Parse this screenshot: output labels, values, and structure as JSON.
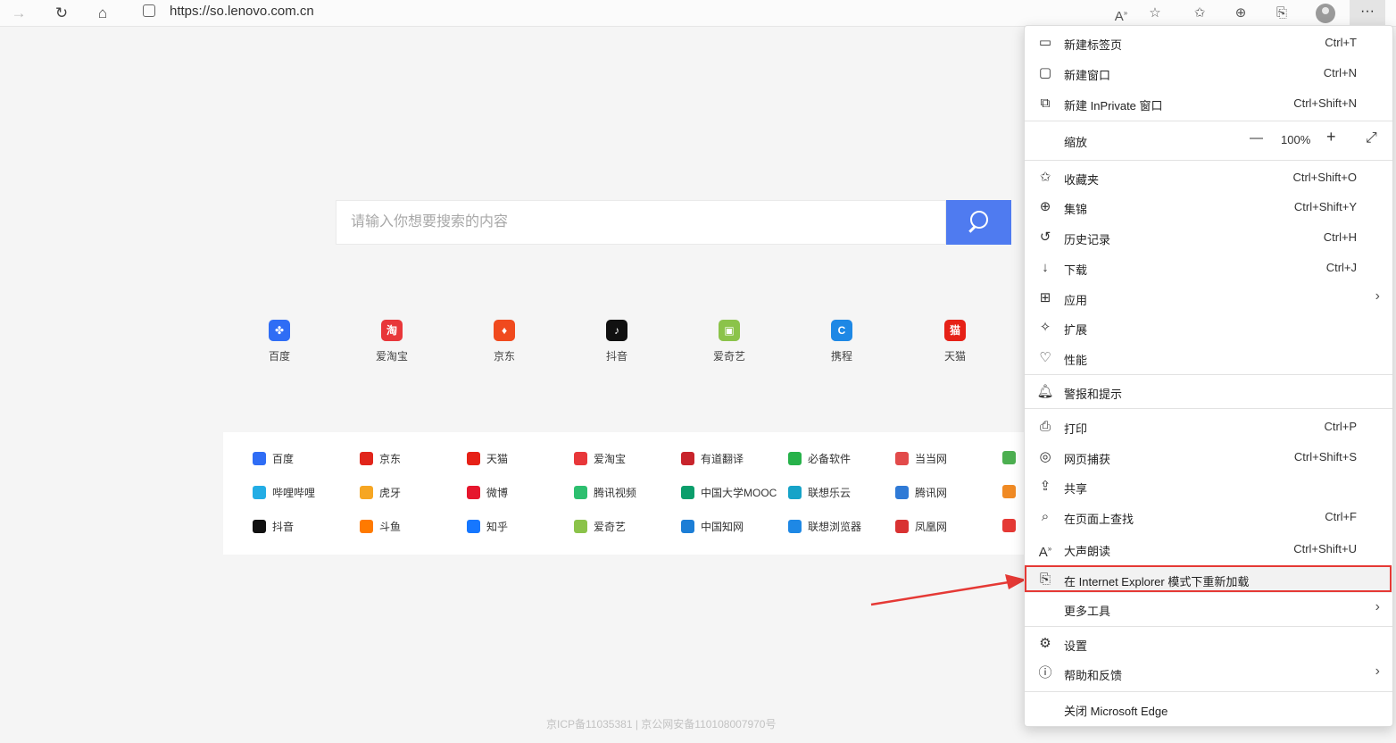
{
  "browser": {
    "url": "https://so.lenovo.com.cn",
    "more_label": "···"
  },
  "search": {
    "placeholder": "请输入你想要搜索的内容"
  },
  "quick_links": [
    {
      "label": "百度",
      "icon": "baidu-icon",
      "color": "#2f6df5",
      "glyph": "✤"
    },
    {
      "label": "爱淘宝",
      "icon": "taobao-icon",
      "color": "#e8373a",
      "glyph": "淘"
    },
    {
      "label": "京东",
      "icon": "jd-icon",
      "color": "#f04a1e",
      "glyph": "♦"
    },
    {
      "label": "抖音",
      "icon": "douyin-icon",
      "color": "#111111",
      "glyph": "♪"
    },
    {
      "label": "爱奇艺",
      "icon": "iqiyi-icon",
      "color": "#8bc34a",
      "glyph": "▣"
    },
    {
      "label": "携程",
      "icon": "ctrip-icon",
      "color": "#1e88e5",
      "glyph": "C"
    },
    {
      "label": "天猫",
      "icon": "tmall-icon",
      "color": "#e62117",
      "glyph": "猫"
    }
  ],
  "grid_links": [
    [
      {
        "label": "百度",
        "color": "#2f6df5"
      },
      {
        "label": "京东",
        "color": "#e1251b"
      },
      {
        "label": "天猫",
        "color": "#e62117"
      },
      {
        "label": "爱淘宝",
        "color": "#e8373a"
      },
      {
        "label": "有道翻译",
        "color": "#c8242c"
      },
      {
        "label": "必备软件",
        "color": "#27b24a"
      },
      {
        "label": "当当网",
        "color": "#e24b4b"
      },
      {
        "label": "",
        "color": "#4caf50"
      }
    ],
    [
      {
        "label": "哔哩哔哩",
        "color": "#23ade5"
      },
      {
        "label": "虎牙",
        "color": "#f6a623"
      },
      {
        "label": "微博",
        "color": "#e6162d"
      },
      {
        "label": "腾讯视频",
        "color": "#2dbf6f"
      },
      {
        "label": "中国大学MOOC",
        "color": "#0a9e6b"
      },
      {
        "label": "联想乐云",
        "color": "#16a3c8"
      },
      {
        "label": "腾讯网",
        "color": "#2f7ad6"
      },
      {
        "label": "",
        "color": "#f08a24"
      }
    ],
    [
      {
        "label": "抖音",
        "color": "#111111"
      },
      {
        "label": "斗鱼",
        "color": "#ff7a00"
      },
      {
        "label": "知乎",
        "color": "#1677ff"
      },
      {
        "label": "爱奇艺",
        "color": "#8bc34a"
      },
      {
        "label": "中国知网",
        "color": "#1c7ed6"
      },
      {
        "label": "联想浏览器",
        "color": "#1e88e5"
      },
      {
        "label": "凤凰网",
        "color": "#d93232"
      },
      {
        "label": "",
        "color": "#e53935"
      }
    ]
  ],
  "footer": "京ICP备11035381 | 京公网安备110108007970号",
  "menu": {
    "new_tab": {
      "label": "新建标签页",
      "shortcut": "Ctrl+T"
    },
    "new_window": {
      "label": "新建窗口",
      "shortcut": "Ctrl+N"
    },
    "new_inprivate": {
      "label": "新建 InPrivate 窗口",
      "shortcut": "Ctrl+Shift+N"
    },
    "zoom": {
      "label": "缩放",
      "value": "100%",
      "minus": "—",
      "plus": "+"
    },
    "favorites": {
      "label": "收藏夹",
      "shortcut": "Ctrl+Shift+O"
    },
    "collections": {
      "label": "集锦",
      "shortcut": "Ctrl+Shift+Y"
    },
    "history": {
      "label": "历史记录",
      "shortcut": "Ctrl+H"
    },
    "downloads": {
      "label": "下载",
      "shortcut": "Ctrl+J"
    },
    "apps": {
      "label": "应用"
    },
    "extensions": {
      "label": "扩展"
    },
    "performance": {
      "label": "性能"
    },
    "alerts": {
      "label": "警报和提示"
    },
    "print": {
      "label": "打印",
      "shortcut": "Ctrl+P"
    },
    "web_capture": {
      "label": "网页捕获",
      "shortcut": "Ctrl+Shift+S"
    },
    "share": {
      "label": "共享"
    },
    "find": {
      "label": "在页面上查找",
      "shortcut": "Ctrl+F"
    },
    "read_aloud": {
      "label": "大声朗读",
      "shortcut": "Ctrl+Shift+U"
    },
    "ie_mode": {
      "label": "在 Internet Explorer 模式下重新加载"
    },
    "more_tools": {
      "label": "更多工具"
    },
    "settings": {
      "label": "设置"
    },
    "help": {
      "label": "帮助和反馈"
    },
    "close": {
      "label": "关闭 Microsoft Edge"
    }
  },
  "colors": {
    "accent": "#4f7bf0",
    "highlight": "#e53935"
  }
}
